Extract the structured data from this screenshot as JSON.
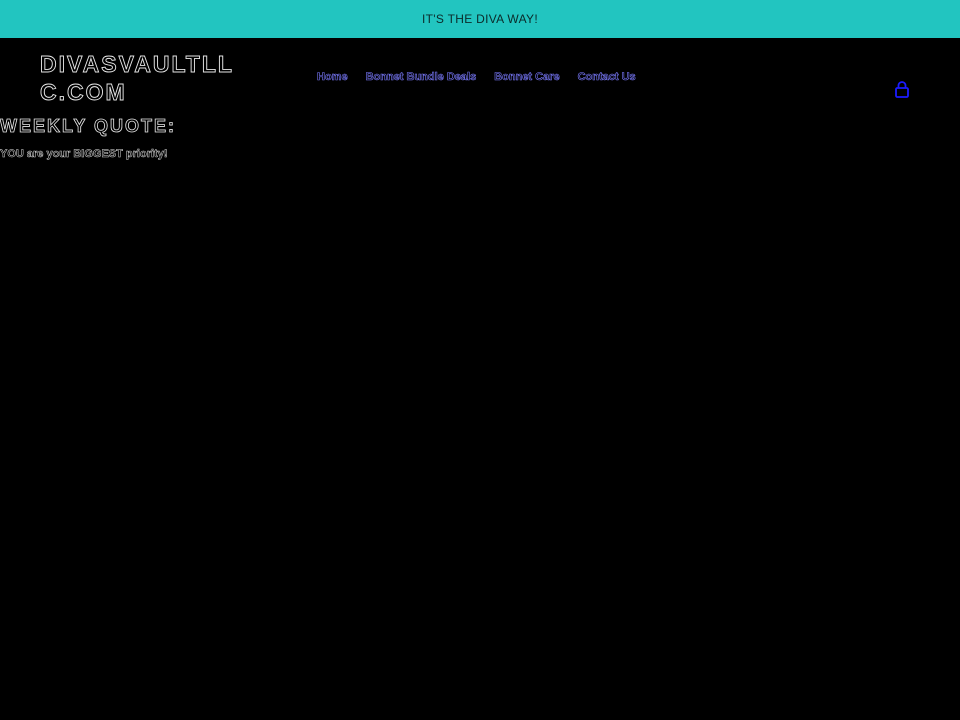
{
  "announcement": {
    "text": "IT'S THE DIVA WAY!"
  },
  "header": {
    "logo_text": "DIVASVAULTLLC.COM",
    "nav": [
      {
        "label": "Home"
      },
      {
        "label": "Bonnet Bundle Deals"
      },
      {
        "label": "Bonnet Care"
      },
      {
        "label": "Contact Us"
      }
    ],
    "cart_icon": "shopping-bag-icon"
  },
  "main": {
    "title": "WEEKLY QUOTE:",
    "quote": "YOU are your BIGGEST priority!"
  },
  "colors": {
    "announcement_bg": "#22c5c0",
    "page_bg": "#000000",
    "nav_link": "#7b7bff",
    "cart_icon": "#1b1bff"
  }
}
